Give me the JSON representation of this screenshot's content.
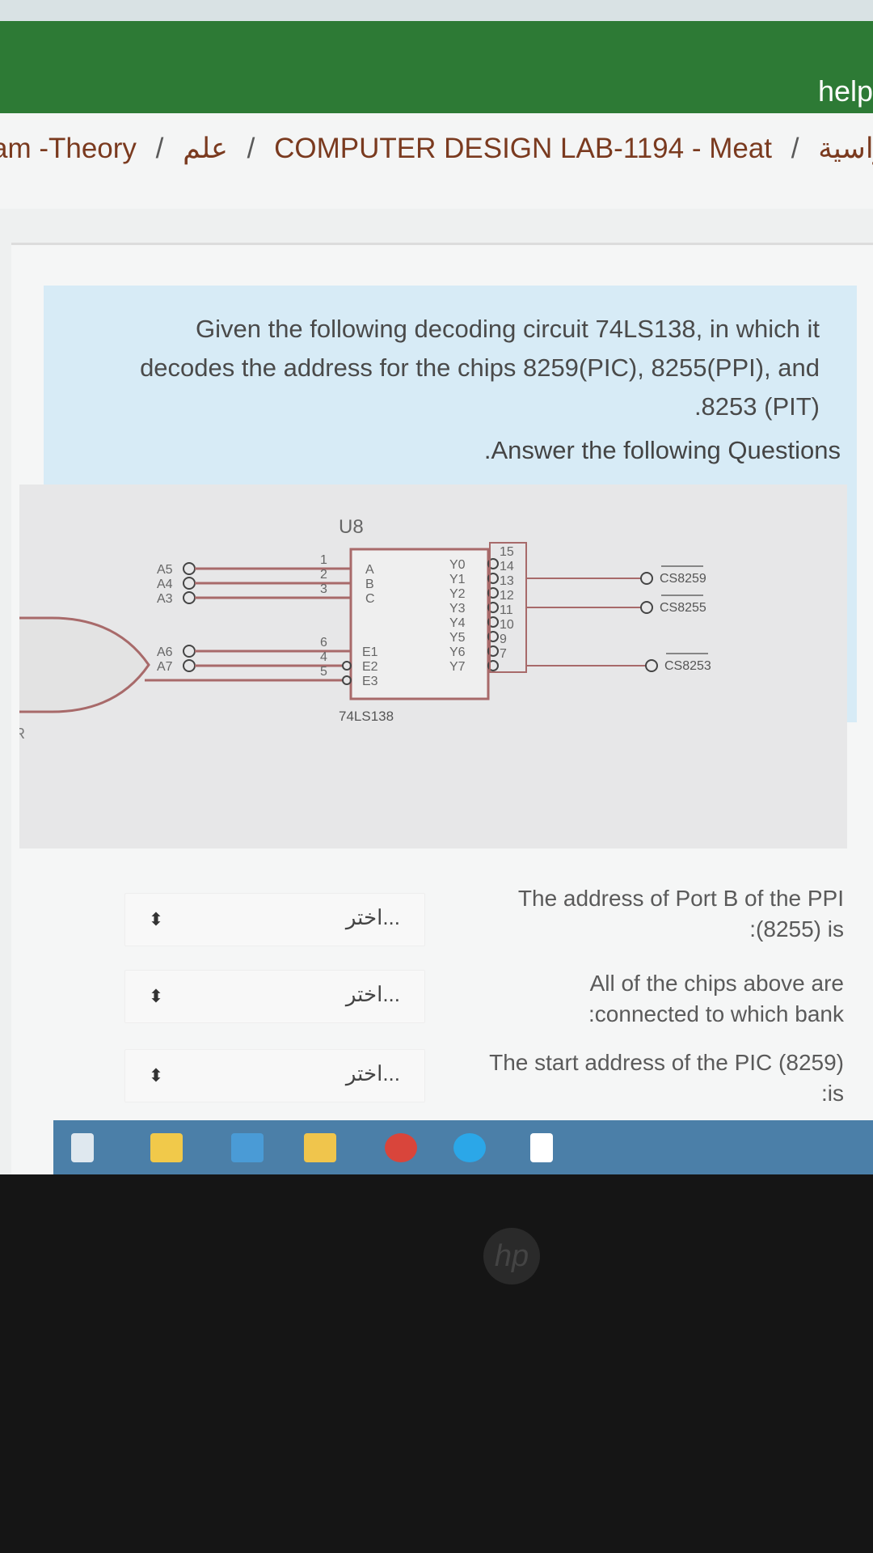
{
  "header": {
    "help_label": "help"
  },
  "breadcrumb": {
    "items": [
      "am -Theory",
      "علم",
      "COMPUTER DESIGN LAB-1194 - Meat",
      "الدراسية"
    ],
    "separator": "/"
  },
  "question": {
    "intro_lines": [
      "Given the following decoding circuit 74LS138, in which it",
      "decodes the address for the chips 8259(PIC), 8255(PPI), and",
      ".8253 (PIT)"
    ],
    "instruction": ".Answer the following Questions"
  },
  "diagram": {
    "chip_label": "U8",
    "chip_part": "74LS138",
    "inputs_abc": [
      "A5",
      "A4",
      "A3"
    ],
    "inputs_enable": [
      "A6",
      "A7"
    ],
    "pin_numbers_left": [
      "1",
      "2",
      "3",
      "6",
      "4",
      "5"
    ],
    "chip_left_pins": [
      "A",
      "B",
      "C",
      "E1",
      "E2",
      "E3"
    ],
    "chip_right_pins": [
      "Y0",
      "Y1",
      "Y2",
      "Y3",
      "Y4",
      "Y5",
      "Y6",
      "Y7"
    ],
    "pin_numbers_right": [
      "15",
      "14",
      "13",
      "12",
      "11",
      "10",
      "9",
      "7"
    ],
    "outputs": [
      "CS8259",
      "CS8255",
      "CS8253"
    ],
    "or_gate_label": "R"
  },
  "answers": [
    {
      "placeholder": "اختر...",
      "lines": [
        "The address of Port B of the PPI",
        ":(8255) is"
      ]
    },
    {
      "placeholder": "اختر...",
      "lines": [
        "All of the chips above are",
        ":connected to which bank"
      ]
    },
    {
      "placeholder": "اختر...",
      "lines": [
        "The start address of the PIC (8259)",
        ":is"
      ]
    }
  ],
  "taskbar": {
    "icons": [
      "task-view-icon",
      "store-icon",
      "mail-icon",
      "file-explorer-icon",
      "chrome-icon",
      "edge-icon",
      "file-icon"
    ]
  },
  "bezel": {
    "logo": "hp"
  }
}
